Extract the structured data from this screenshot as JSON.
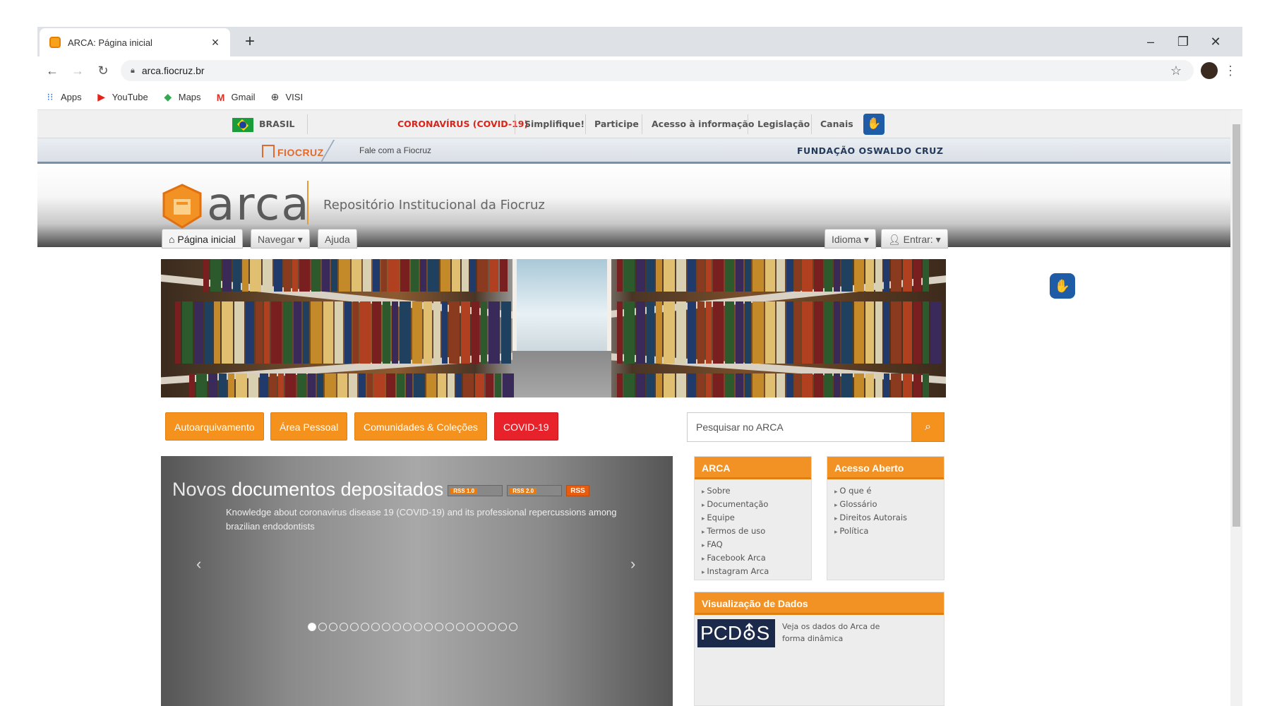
{
  "browser": {
    "tab_title": "ARCA: Página inicial",
    "new_tab": "+",
    "close_tab": "×",
    "url": "arca.fiocruz.br",
    "bookmarks": [
      {
        "label": "Apps",
        "icon": "apps-grid-icon"
      },
      {
        "label": "YouTube",
        "icon": "youtube-icon"
      },
      {
        "label": "Maps",
        "icon": "maps-icon"
      },
      {
        "label": "Gmail",
        "icon": "gmail-icon"
      },
      {
        "label": "VISI",
        "icon": "globe-icon"
      }
    ]
  },
  "govbar": {
    "brasil": "BRASIL",
    "covid": "CORONAVÍRUS (COVID-19)",
    "simplifique": "Simplifique!",
    "participe": "Participe",
    "acesso": "Acesso à informação",
    "legislacao": "Legislação",
    "canais": "Canais"
  },
  "fiocruzbar": {
    "logo": "FIOCRUZ",
    "fale": "Fale com a Fiocruz",
    "fundacao": "FUNDAÇÃO OSWALDO CRUZ"
  },
  "header": {
    "word": "arca",
    "tagline": "Repositório Institucional da Fiocruz"
  },
  "nav": {
    "home": "Página inicial",
    "navegar": "Navegar ▾",
    "ajuda": "Ajuda",
    "idioma": "Idioma ▾",
    "entrar": "Entrar: ▾"
  },
  "actions": {
    "auto": "Autoarquivamento",
    "pessoal": "Área Pessoal",
    "comunidades": "Comunidades & Coleções",
    "covid": "COVID-19",
    "search_placeholder": "Pesquisar no ARCA"
  },
  "carousel": {
    "title_a": "Novos",
    "title_b": "documentos depositados",
    "feed1": "RSS 1.0",
    "feed2": "RSS 2.0",
    "feed3": "RSS",
    "text": "Knowledge about coronavirus disease 19 (COVID-19) and its professional repercussions among brazilian endodontists",
    "prev": "‹",
    "next": "›",
    "dot_count": 20,
    "active_dot": 0
  },
  "panels": {
    "arca": {
      "title": "ARCA",
      "items": [
        "Sobre",
        "Documentação",
        "Equipe",
        "Termos de uso",
        "FAQ",
        "Facebook Arca",
        "Instagram Arca"
      ]
    },
    "aberto": {
      "title": "Acesso Aberto",
      "items": [
        "O que é",
        "Glossário",
        "Direitos Autorais",
        "Política"
      ]
    },
    "dados": {
      "title": "Visualização de Dados",
      "logo": "PCD⛢S",
      "text": "Veja os dados do Arca de forma dinâmica"
    }
  },
  "colors": {
    "accent": "#f5921e",
    "covid": "#e8222b",
    "a11y": "#1f5ca8"
  }
}
